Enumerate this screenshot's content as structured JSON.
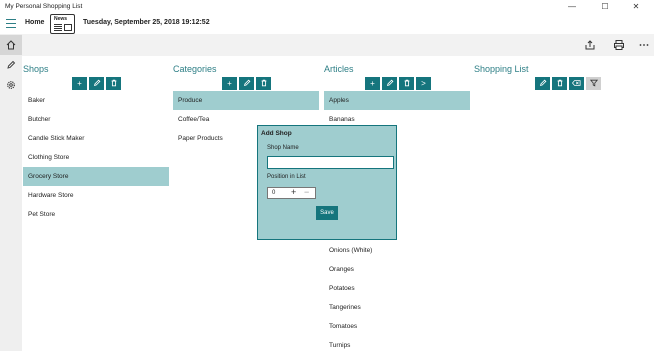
{
  "window": {
    "title": "My Personal Shopping List",
    "minimize": "—",
    "maximize": "☐",
    "close": "✕"
  },
  "header": {
    "home": "Home",
    "logo_text": "News",
    "datetime": "Tuesday, September 25, 2018 19:12:52"
  },
  "shops": {
    "heading": "Shops",
    "items": [
      "Baker",
      "Butcher",
      "Candle Stick Maker",
      "Clothing Store",
      "Grocery Store",
      "Hardware Store",
      "Pet Store"
    ],
    "selected": "Grocery Store"
  },
  "categories": {
    "heading": "Categories",
    "items": [
      "Produce",
      "Coffee/Tea",
      "Paper Products"
    ],
    "selected": "Produce"
  },
  "articles": {
    "heading": "Articles",
    "items_top": [
      "Apples",
      "Bananas"
    ],
    "items_bottom": [
      "Onions (White)",
      "Oranges",
      "Potatoes",
      "Tangerines",
      "Tomatoes",
      "Turnips"
    ],
    "selected": "Apples"
  },
  "shopping_list": {
    "heading": "Shopping List"
  },
  "dialog": {
    "title": "Add Shop",
    "name_label": "Shop Name",
    "name_value": "",
    "position_label": "Position in List",
    "position_value": "0",
    "save": "Save"
  },
  "colors": {
    "accent": "#15757d",
    "selection": "#9fcdcf",
    "heading": "#2e7f86"
  }
}
